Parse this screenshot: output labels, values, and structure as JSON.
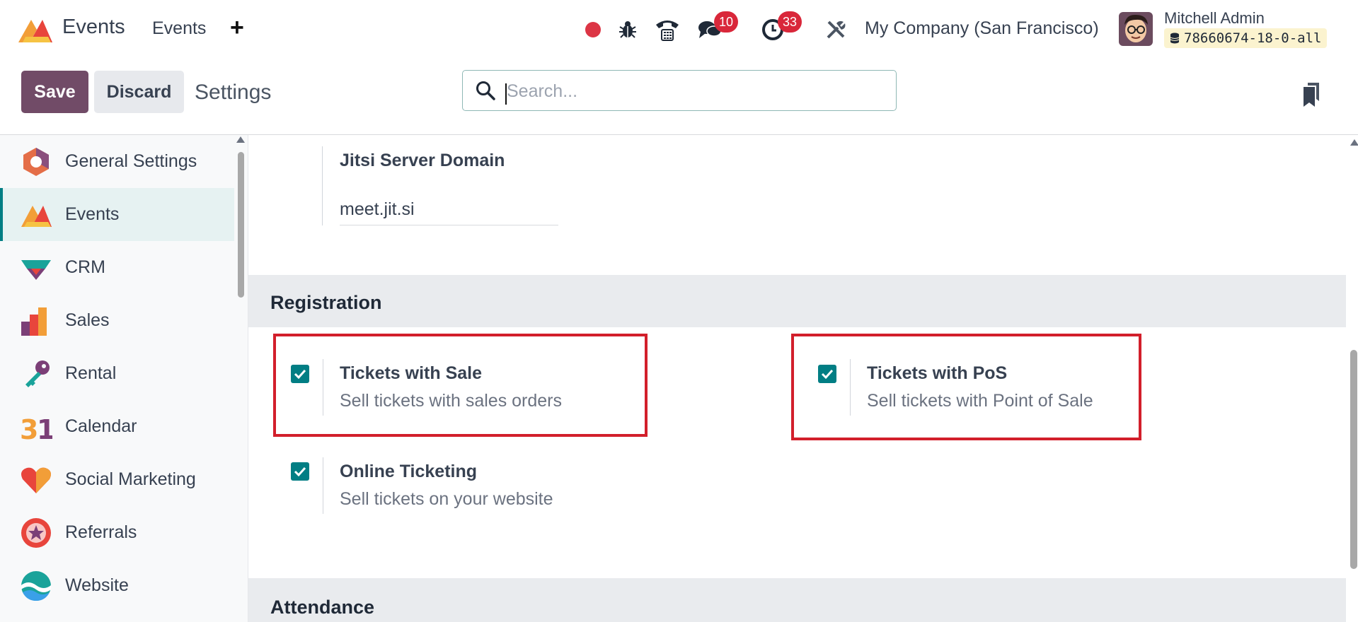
{
  "navbar": {
    "app_name": "Events",
    "menu": [
      "Events"
    ],
    "new_icon": "plus-icon",
    "icons": [
      "record-dot-icon",
      "bug-icon",
      "phone-icon",
      "chat-icon",
      "clock-icon",
      "tools-icon"
    ],
    "chat_badge": "10",
    "activity_badge": "33",
    "company": "My Company (San Francisco)",
    "user_name": "Mitchell Admin",
    "database": "78660674-18-0-all"
  },
  "control_panel": {
    "save_label": "Save",
    "discard_label": "Discard",
    "title": "Settings",
    "search_placeholder": "Search..."
  },
  "sidebar": {
    "items": [
      {
        "label": "General Settings",
        "icon": "general-settings-icon"
      },
      {
        "label": "Events",
        "icon": "events-icon",
        "active": true
      },
      {
        "label": "CRM",
        "icon": "crm-icon"
      },
      {
        "label": "Sales",
        "icon": "sales-icon"
      },
      {
        "label": "Rental",
        "icon": "rental-icon"
      },
      {
        "label": "Calendar",
        "icon": "calendar-icon"
      },
      {
        "label": "Social Marketing",
        "icon": "social-marketing-icon"
      },
      {
        "label": "Referrals",
        "icon": "referrals-icon"
      },
      {
        "label": "Website",
        "icon": "website-icon"
      }
    ]
  },
  "main": {
    "jitsi": {
      "label": "Jitsi Server Domain",
      "value": "meet.jit.si"
    },
    "registration": {
      "title": "Registration",
      "settings": [
        {
          "title": "Tickets with Sale",
          "description": "Sell tickets with sales orders",
          "checked": true
        },
        {
          "title": "Tickets with PoS",
          "description": "Sell tickets with Point of Sale",
          "checked": true
        },
        {
          "title": "Online Ticketing",
          "description": "Sell tickets on your website",
          "checked": true
        }
      ]
    },
    "attendance": {
      "title": "Attendance"
    }
  },
  "colors": {
    "primary": "#714b67",
    "checkbox": "#017e84",
    "badge": "#d9273a",
    "highlight": "#d21f2b"
  }
}
